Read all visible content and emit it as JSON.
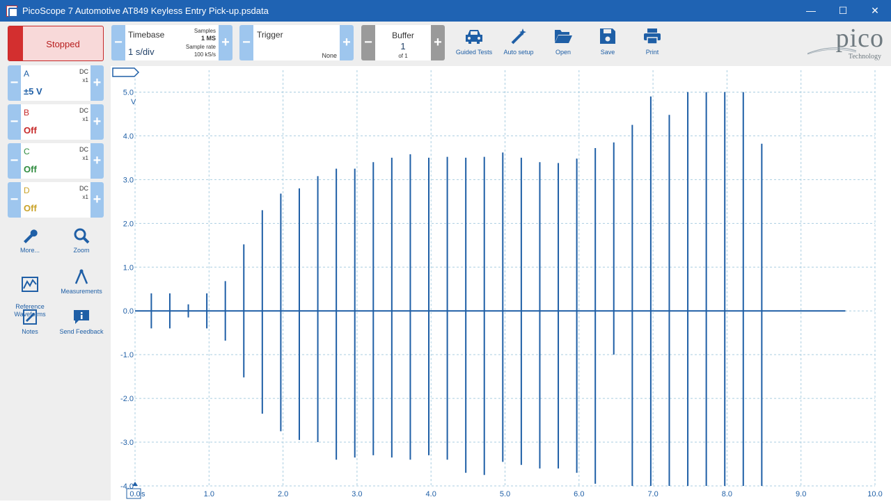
{
  "window": {
    "title": "PicoScope 7 Automotive AT849 Keyless Entry Pick-up.psdata",
    "minimize": "—",
    "maximize": "☐",
    "close": "✕"
  },
  "run_state": {
    "label": "Stopped"
  },
  "channels": [
    {
      "name": "A",
      "coupling": "DC",
      "probe": "x1",
      "range": "±5 V",
      "color": "#1f5fa6"
    },
    {
      "name": "B",
      "coupling": "DC",
      "probe": "x1",
      "range": "Off",
      "color": "#c62828"
    },
    {
      "name": "C",
      "coupling": "DC",
      "probe": "x1",
      "range": "Off",
      "color": "#2e8b3e"
    },
    {
      "name": "D",
      "coupling": "DC",
      "probe": "x1",
      "range": "Off",
      "color": "#c9a227"
    }
  ],
  "side_tools": [
    {
      "label": "More...",
      "icon": "wrench-icon"
    },
    {
      "label": "Zoom",
      "icon": "zoom-icon"
    },
    {
      "label": "Reference\nWaveforms",
      "icon": "reference-waveforms-icon"
    },
    {
      "label": "Measurements",
      "icon": "measurements-icon"
    },
    {
      "label": "Notes",
      "icon": "notes-icon"
    },
    {
      "label": "Send Feedback",
      "icon": "feedback-icon"
    }
  ],
  "toolbar": {
    "timebase": {
      "title": "Timebase",
      "value": "1 s/div",
      "samples_label": "Samples",
      "samples_value": "1 MS",
      "rate_label": "Sample rate",
      "rate_value": "100 kS/s"
    },
    "trigger": {
      "title": "Trigger",
      "mode": "None"
    },
    "buffer": {
      "title": "Buffer",
      "value": "1",
      "of": "of 1"
    },
    "buttons": [
      {
        "label": "Guided Tests",
        "icon": "car-icon"
      },
      {
        "label": "Auto setup",
        "icon": "magic-wand-icon"
      },
      {
        "label": "Open",
        "icon": "folder-open-icon"
      },
      {
        "label": "Save",
        "icon": "save-icon"
      },
      {
        "label": "Print",
        "icon": "print-icon"
      }
    ],
    "logo": {
      "word": "pico",
      "tagline": "Technology"
    }
  },
  "chart_data": {
    "type": "line",
    "x_unit": "s",
    "y_unit": "V",
    "xlim": [
      0,
      10
    ],
    "ylim": [
      -4,
      5.5
    ],
    "x_ticks": [
      "0.0",
      "1.0",
      "2.0",
      "3.0",
      "4.0",
      "5.0",
      "6.0",
      "7.0",
      "8.0",
      "9.0",
      "10.0"
    ],
    "y_ticks": [
      "5.0",
      "4.0",
      "3.0",
      "2.0",
      "1.0",
      "0.0",
      "-1.0",
      "-2.0",
      "-3.0",
      "-4.0"
    ],
    "grid": true,
    "color": "#1f5fa6",
    "trace_end": 9.6,
    "pulses": [
      {
        "t": 0.22,
        "max": 0.4,
        "min": -0.4
      },
      {
        "t": 0.47,
        "max": 0.4,
        "min": -0.4
      },
      {
        "t": 0.72,
        "max": 0.15,
        "min": -0.15
      },
      {
        "t": 0.97,
        "max": 0.4,
        "min": -0.4
      },
      {
        "t": 1.22,
        "max": 0.68,
        "min": -0.68
      },
      {
        "t": 1.47,
        "max": 1.52,
        "min": -1.52
      },
      {
        "t": 1.72,
        "max": 2.3,
        "min": -2.35
      },
      {
        "t": 1.97,
        "max": 2.68,
        "min": -2.75
      },
      {
        "t": 2.22,
        "max": 2.8,
        "min": -2.95
      },
      {
        "t": 2.47,
        "max": 3.08,
        "min": -3.0
      },
      {
        "t": 2.72,
        "max": 3.25,
        "min": -3.4
      },
      {
        "t": 2.97,
        "max": 3.25,
        "min": -3.35
      },
      {
        "t": 3.22,
        "max": 3.4,
        "min": -3.3
      },
      {
        "t": 3.47,
        "max": 3.5,
        "min": -3.35
      },
      {
        "t": 3.72,
        "max": 3.58,
        "min": -3.4
      },
      {
        "t": 3.97,
        "max": 3.5,
        "min": -3.3
      },
      {
        "t": 4.22,
        "max": 3.52,
        "min": -3.4
      },
      {
        "t": 4.47,
        "max": 3.5,
        "min": -3.7
      },
      {
        "t": 4.72,
        "max": 3.52,
        "min": -3.75
      },
      {
        "t": 4.97,
        "max": 3.62,
        "min": -3.45
      },
      {
        "t": 5.22,
        "max": 3.5,
        "min": -3.52
      },
      {
        "t": 5.47,
        "max": 3.4,
        "min": -3.6
      },
      {
        "t": 5.72,
        "max": 3.38,
        "min": -3.6
      },
      {
        "t": 5.97,
        "max": 3.48,
        "min": -3.7
      },
      {
        "t": 6.22,
        "max": 3.72,
        "min": -3.95
      },
      {
        "t": 6.47,
        "max": 3.85,
        "min": -1.0
      },
      {
        "t": 6.72,
        "max": 4.25,
        "min": -4.0
      },
      {
        "t": 6.97,
        "max": 4.9,
        "min": -4.0
      },
      {
        "t": 7.22,
        "max": 4.48,
        "min": -4.0
      },
      {
        "t": 7.47,
        "max": 5.0,
        "min": -4.0
      },
      {
        "t": 7.72,
        "max": 5.0,
        "min": -4.0
      },
      {
        "t": 7.97,
        "max": 5.0,
        "min": -4.0
      },
      {
        "t": 8.22,
        "max": 5.0,
        "min": -4.0
      },
      {
        "t": 8.47,
        "max": 3.82,
        "min": -4.0
      }
    ]
  }
}
